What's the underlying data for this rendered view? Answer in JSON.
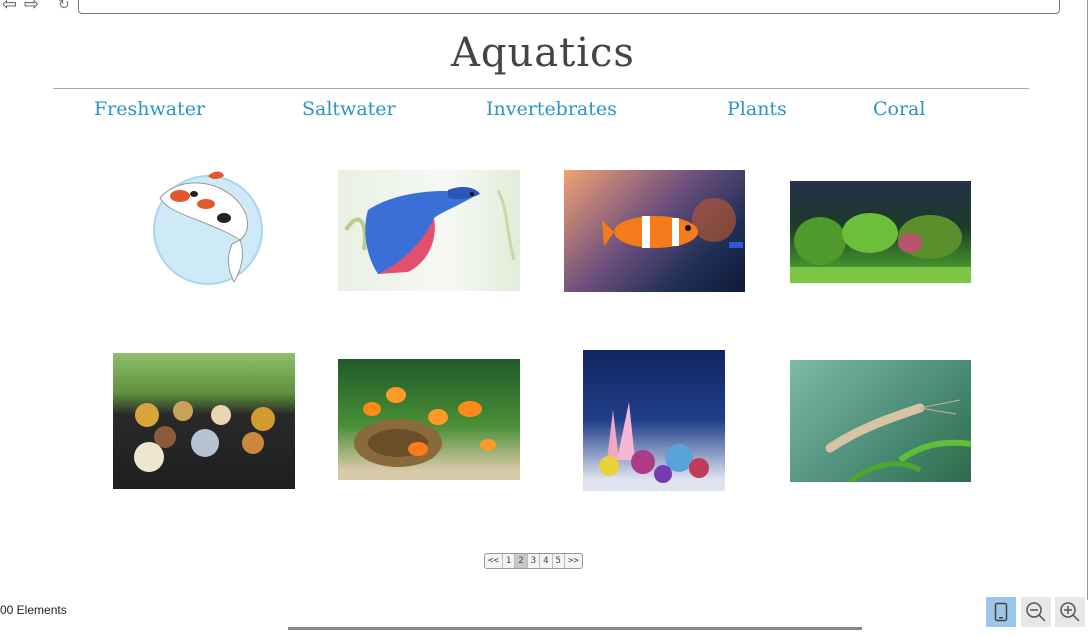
{
  "page": {
    "title": "Aquatics"
  },
  "nav": {
    "items": [
      "Freshwater",
      "Saltwater",
      "Invertebrates",
      "Plants",
      "Coral"
    ]
  },
  "gallery": {
    "images": [
      "koi-fish",
      "betta-fish",
      "clownfish",
      "planted-aquarium",
      "mystery-snails",
      "goldfish",
      "coral-reef",
      "freshwater-shrimp"
    ]
  },
  "pager": {
    "items": [
      "<<",
      "1",
      "2",
      "3",
      "4",
      "5",
      ">>"
    ],
    "active_index": 2
  },
  "status": {
    "elements_count": "00 Elements"
  },
  "toolbar": {
    "icons": [
      "device-icon",
      "zoom-out-icon",
      "zoom-in-icon"
    ]
  },
  "colors": {
    "title": "#444444",
    "nav_link": "#2b94c8",
    "active_tool": "#9cc7ea"
  }
}
